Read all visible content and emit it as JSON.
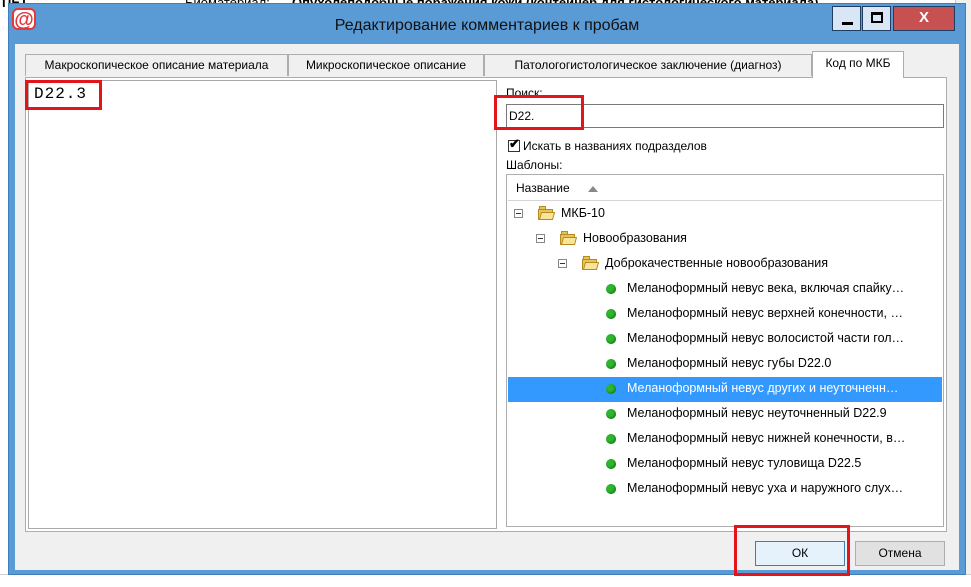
{
  "background": {
    "partial_text_left": "ПЕТ",
    "partial_text_mid": "Биоматериал:",
    "partial_text_right": "Опухолеподобные поражения кожи (контейнер для гистологического материала)"
  },
  "window": {
    "title": "Редактирование комментариев к пробам",
    "icon": "@",
    "close_glyph": "X"
  },
  "tabs": [
    {
      "label": "Макроскопическое описание материала"
    },
    {
      "label": "Микроскопическое описание"
    },
    {
      "label": "Патологогистологическое заключение (диагноз)"
    },
    {
      "label": "Код по МКБ"
    }
  ],
  "left_text": "D22.3",
  "search": {
    "label": "Поиск:",
    "value": "D22."
  },
  "checkbox": {
    "label": "Искать в названиях подразделов",
    "checked": true
  },
  "templates_label": "Шаблоны:",
  "grid": {
    "column": "Название",
    "tree": [
      {
        "label": "МКБ-10"
      },
      {
        "label": "Новообразования"
      },
      {
        "label": "Доброкачественные новообразования"
      }
    ],
    "items": [
      "Меланоформный невус века, включая спайку…",
      "Меланоформный невус верхней конечности, …",
      "Меланоформный невус волосистой части гол…",
      "Меланоформный невус губы D22.0",
      "Меланоформный невус других и неуточненн…",
      "Меланоформный невус неуточненный D22.9",
      "Меланоформный невус нижней конечности, в…",
      "Меланоформный невус туловища D22.5",
      "Меланоформный невус уха и наружного слух…"
    ],
    "selected_index": 4
  },
  "buttons": {
    "ok": "ОК",
    "cancel": "Отмена"
  },
  "colors": {
    "accent": "#3399ff",
    "highlight": "#e4141c",
    "frame": "#5b9bd5"
  }
}
